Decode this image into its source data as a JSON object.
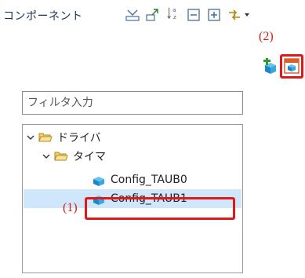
{
  "header": {
    "title": "コンポーネント"
  },
  "toolbar": {
    "icons": [
      "collapse-all-icon",
      "expand-icon",
      "sort-az-icon",
      "collapse-icon",
      "expand-all-icon",
      "link-icon"
    ],
    "add_label": "add-component-icon",
    "open_label": "open-component-icon"
  },
  "annotations": {
    "label_1": "(1)",
    "label_2": "(2)"
  },
  "filter": {
    "placeholder": "フィルタ入力"
  },
  "tree": {
    "items": [
      {
        "label": "ドライバ"
      },
      {
        "label": "タイマ"
      },
      {
        "label": "Config_TAUB0"
      },
      {
        "label": "Config_TAUB1"
      }
    ]
  },
  "colors": {
    "accent_red": "#e01818",
    "selection": "#cfe6fb"
  }
}
